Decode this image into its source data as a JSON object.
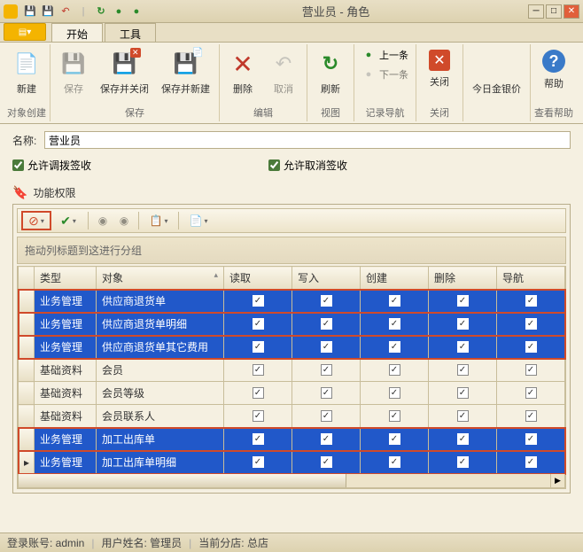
{
  "window": {
    "title": "营业员 - 角色"
  },
  "tabs": {
    "start": "开始",
    "tools": "工具"
  },
  "ribbon": {
    "new": "新建",
    "save": "保存",
    "saveClose": "保存并关闭",
    "saveNew": "保存并新建",
    "delete": "删除",
    "cancel": "取消",
    "refresh": "刷新",
    "prev": "上一条",
    "next": "下一条",
    "close": "关闭",
    "goldPrice": "今日金银价",
    "help": "帮助",
    "groups": {
      "objCreate": "对象创建",
      "save": "保存",
      "edit": "编辑",
      "view": "视图",
      "recNav": "记录导航",
      "closeG": "关闭",
      "viewHelp": "查看帮助"
    }
  },
  "form": {
    "nameLabel": "名称:",
    "nameValue": "营业员",
    "allowTransfer": "允许调拨签收",
    "allowCancelSign": "允许取消签收",
    "permHeader": "功能权限",
    "groupHint": "拖动列标题到这进行分组"
  },
  "columns": {
    "type": "类型",
    "object": "对象",
    "read": "读取",
    "write": "写入",
    "create": "创建",
    "delete": "删除",
    "nav": "导航"
  },
  "rows": [
    {
      "type": "业务管理",
      "object": "供应商退货单",
      "sel": true,
      "read": true,
      "write": true,
      "create": true,
      "delete": true,
      "nav": true
    },
    {
      "type": "业务管理",
      "object": "供应商退货单明细",
      "sel": true,
      "read": true,
      "write": true,
      "create": true,
      "delete": true,
      "nav": true
    },
    {
      "type": "业务管理",
      "object": "供应商退货单其它费用",
      "sel": true,
      "read": true,
      "write": true,
      "create": true,
      "delete": true,
      "nav": true
    },
    {
      "type": "基础资料",
      "object": "会员",
      "sel": false,
      "read": true,
      "write": true,
      "create": true,
      "delete": true,
      "nav": true
    },
    {
      "type": "基础资料",
      "object": "会员等级",
      "sel": false,
      "read": true,
      "write": true,
      "create": true,
      "delete": true,
      "nav": true
    },
    {
      "type": "基础资料",
      "object": "会员联系人",
      "sel": false,
      "read": true,
      "write": true,
      "create": true,
      "delete": true,
      "nav": true
    },
    {
      "type": "业务管理",
      "object": "加工出库单",
      "sel": true,
      "read": true,
      "write": true,
      "create": true,
      "delete": true,
      "nav": true
    },
    {
      "type": "业务管理",
      "object": "加工出库单明细",
      "sel": true,
      "current": true,
      "read": true,
      "write": true,
      "create": true,
      "delete": true,
      "nav": true
    }
  ],
  "status": {
    "account": "登录账号: admin",
    "user": "用户姓名: 管理员",
    "branch": "当前分店: 总店"
  }
}
